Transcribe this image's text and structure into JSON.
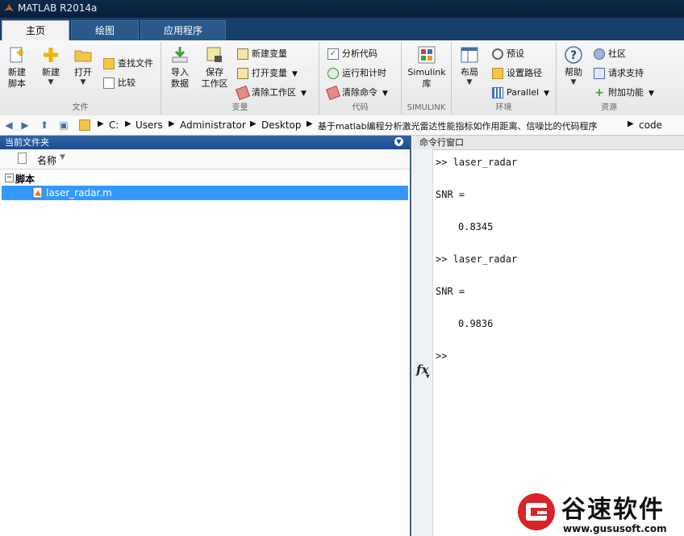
{
  "window": {
    "title": "MATLAB R2014a"
  },
  "tabs": [
    {
      "label": "主页"
    },
    {
      "label": "绘图"
    },
    {
      "label": "应用程序"
    }
  ],
  "ribbon": {
    "file": {
      "group_label": "文件",
      "new_script": "新建\n脚本",
      "new": "新建",
      "open": "打开",
      "find_files": "查找文件",
      "compare": "比较"
    },
    "variable": {
      "group_label": "变量",
      "import_data": "导入\n数据",
      "save_workspace": "保存\n工作区",
      "new_variable": "新建变量",
      "open_variable": "打开变量",
      "clear_workspace": "清除工作区"
    },
    "code": {
      "group_label": "代码",
      "analyze_code": "分析代码",
      "run_and_time": "运行和计时",
      "clear_commands": "清除命令"
    },
    "simulink": {
      "group_label": "SIMULINK",
      "library": "Simulink\n库"
    },
    "environment": {
      "group_label": "环境",
      "layout": "布局",
      "preferences": "预设",
      "set_path": "设置路径",
      "parallel": "Parallel"
    },
    "resources": {
      "group_label": "资源",
      "help": "帮助",
      "community": "社区",
      "request_support": "请求支持",
      "add_ons": "附加功能"
    }
  },
  "address": {
    "crumbs": [
      "C:",
      "Users",
      "Administrator",
      "Desktop",
      "基于matlab编程分析激光雷达性能指标如作用距离、信噪比的代码程序",
      "code"
    ]
  },
  "current_folder": {
    "title": "当前文件夹",
    "column_name": "名称",
    "group": "脚本",
    "files": [
      "laser_radar.m"
    ]
  },
  "command_window": {
    "title": "命令行窗口",
    "lines": [
      ">> laser_radar",
      "SNR =",
      "0.8345",
      ">> laser_radar",
      "SNR =",
      "0.9836"
    ],
    "prompt": ">>"
  },
  "watermark": {
    "brand": "谷速软件",
    "url": "www.gususoft.com"
  },
  "colors": {
    "tab_bg": "#173f6b",
    "panel_header": "#1c4c8f",
    "selection": "#3399ff",
    "watermark_red": "#d8232a"
  }
}
